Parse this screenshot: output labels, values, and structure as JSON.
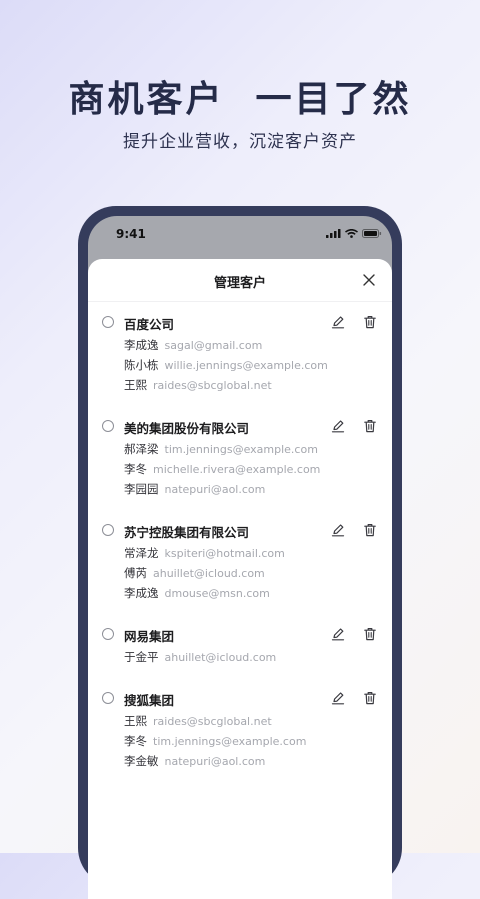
{
  "hero": {
    "title": "商机客户  一目了然",
    "subtitle": "提升企业营收，沉淀客户资产"
  },
  "status_bar": {
    "time": "9:41",
    "icons": [
      "signal-icon",
      "wifi-icon",
      "battery-icon"
    ]
  },
  "sheet": {
    "title": "管理客户",
    "close_icon": "close-icon"
  },
  "companies": [
    {
      "name": "百度公司",
      "contacts": [
        {
          "name": "李成逸",
          "email": "sagal@gmail.com"
        },
        {
          "name": "陈小栋",
          "email": "willie.jennings@example.com"
        },
        {
          "name": "王熙",
          "email": "raides@sbcglobal.net"
        }
      ]
    },
    {
      "name": "美的集团股份有限公司",
      "contacts": [
        {
          "name": "郝泽梁",
          "email": "tim.jennings@example.com"
        },
        {
          "name": "李冬",
          "email": "michelle.rivera@example.com"
        },
        {
          "name": "李园园",
          "email": "natepuri@aol.com"
        }
      ]
    },
    {
      "name": "苏宁控股集团有限公司",
      "contacts": [
        {
          "name": "常泽龙",
          "email": "kspiteri@hotmail.com"
        },
        {
          "name": "傅芮",
          "email": "ahuillet@icloud.com"
        },
        {
          "name": "李成逸",
          "email": "dmouse@msn.com"
        }
      ]
    },
    {
      "name": "网易集团",
      "contacts": [
        {
          "name": "于金平",
          "email": "ahuillet@icloud.com"
        }
      ]
    },
    {
      "name": "搜狐集团",
      "contacts": [
        {
          "name": "王熙",
          "email": "raides@sbcglobal.net"
        },
        {
          "name": "李冬",
          "email": "tim.jennings@example.com"
        },
        {
          "name": "李金敏",
          "email": "natepuri@aol.com"
        }
      ]
    }
  ],
  "colors": {
    "frame": "#353c5c",
    "title_text": "#252b48",
    "email_text": "#a5a7ae"
  }
}
